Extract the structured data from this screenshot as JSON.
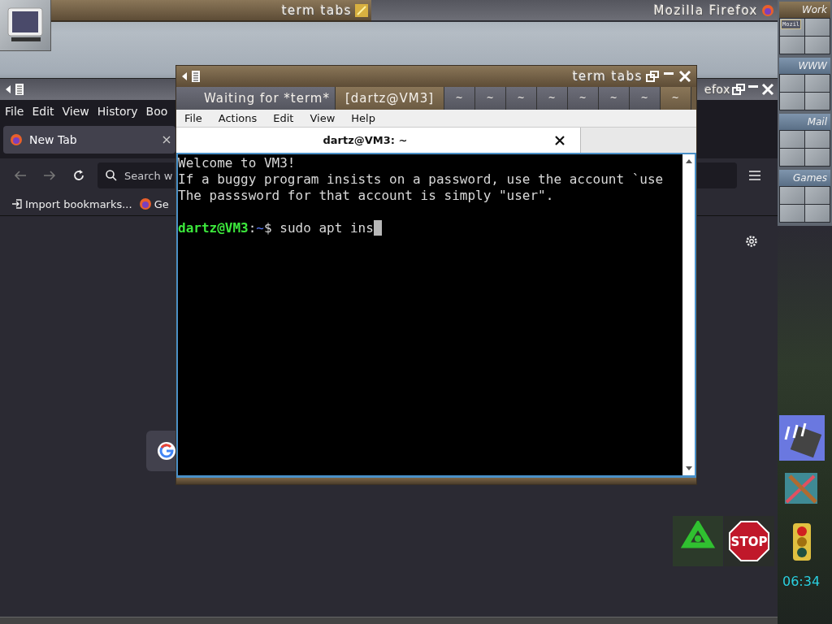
{
  "desktop_bar": {
    "left_title": "term tabs",
    "right_title": "Mozilla Firefox"
  },
  "pager": [
    {
      "label": "Work",
      "selected": true,
      "windows": [
        "Mozil"
      ]
    },
    {
      "label": "WWW",
      "selected": false
    },
    {
      "label": "Mail",
      "selected": false
    },
    {
      "label": "Games",
      "selected": false
    }
  ],
  "firefox": {
    "title": "efox",
    "menu": [
      "File",
      "Edit",
      "View",
      "History",
      "Boo"
    ],
    "tab": {
      "label": "New Tab"
    },
    "search": {
      "placeholder": "Search w"
    },
    "bookmarks": [
      {
        "kind": "import",
        "label": "Import bookmarks..."
      },
      {
        "kind": "site",
        "label": "Ge"
      }
    ]
  },
  "terminal": {
    "title": "term tabs",
    "tabs": [
      {
        "label": "Waiting for *term*",
        "selected": false
      },
      {
        "label": "[dartz@VM3]",
        "selected": true
      },
      {
        "label": "~",
        "selected": false
      },
      {
        "label": "~",
        "selected": false
      },
      {
        "label": "~",
        "selected": false
      },
      {
        "label": "~",
        "selected": false
      },
      {
        "label": "~",
        "selected": false
      },
      {
        "label": "~",
        "selected": false
      },
      {
        "label": "~",
        "selected": false
      },
      {
        "label": "~",
        "selected": true
      }
    ],
    "menu": [
      "File",
      "Actions",
      "Edit",
      "View",
      "Help"
    ],
    "session_tab": "dartz@VM3: ~",
    "lines": [
      "Welcome to VM3!",
      "If a buggy program insists on a password, use the account `use",
      "The passsword for that account is simply \"user\"."
    ],
    "prompt": {
      "user": "dartz@VM3",
      "separator": ":",
      "path": "~",
      "command": "$ sudo apt ins"
    }
  },
  "dock": {
    "stop_label": "STOP",
    "clock": "06:34"
  }
}
